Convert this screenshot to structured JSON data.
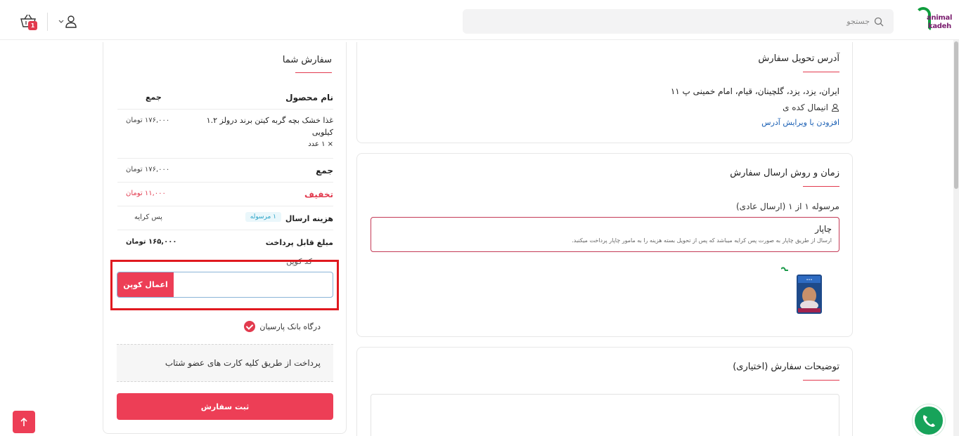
{
  "header": {
    "logo_word1": "animal",
    "logo_word2": "kadeh",
    "search_placeholder": "جستجو",
    "cart_count": "1"
  },
  "address": {
    "title": "آدرس تحویل سفارش",
    "text": "ایران، یزد، یزد، گلچینان، قیام، امام خمینی پ ۱۱",
    "name": "انیمال کده ی",
    "edit_link": "افزودن یا ویرایش آدرس"
  },
  "shipping": {
    "title": "زمان و روش ارسال سفارش",
    "subtitle": "مرسوله ۱ از ۱ (ارسال عادی)",
    "option_name": "چاپار",
    "option_desc": "ارسال از طریق چاپار به صورت پس کرایه میباشد که پس از تحویل بسته هزینه را به مامور چاپار پرداخت میکنبد."
  },
  "notes": {
    "title": "توضیحات سفارش (اختیاری)"
  },
  "order": {
    "title": "سفارش شما",
    "col_product": "نام محصول",
    "col_total": "جمع",
    "item_name_line1": "غذا خشک بچه گربه کیتن برند درولز ۱.۲",
    "item_name_line2": "کیلویی",
    "item_qty": "× ۱ عدد",
    "item_price": "۱۷۶,۰۰۰ تومان",
    "subtotal_label": "جمع",
    "subtotal_value": "۱۷۶,۰۰۰ تومان",
    "discount_label": "تخفیف",
    "discount_value": "۱۱,۰۰۰ تومان",
    "shipping_label": "هزینه ارسال",
    "shipping_chip": "۱ مرسوله",
    "shipping_value": "پس کرایه",
    "payable_label": "مبلغ قابل پرداخت",
    "payable_value": "۱۶۵,۰۰۰ تومان",
    "coupon_label": "کد کوپن",
    "coupon_button": "اعمال کوپن",
    "gateway_label": "درگاه بانک پارسیان",
    "gateway_desc": "پرداخت از طریق کلیه کارت های عضو شتاب",
    "submit_button": "ثبت سفارش"
  },
  "colors": {
    "accent": "#ed3e56",
    "link": "#1a5fb4",
    "highlight": "#e0191f"
  }
}
